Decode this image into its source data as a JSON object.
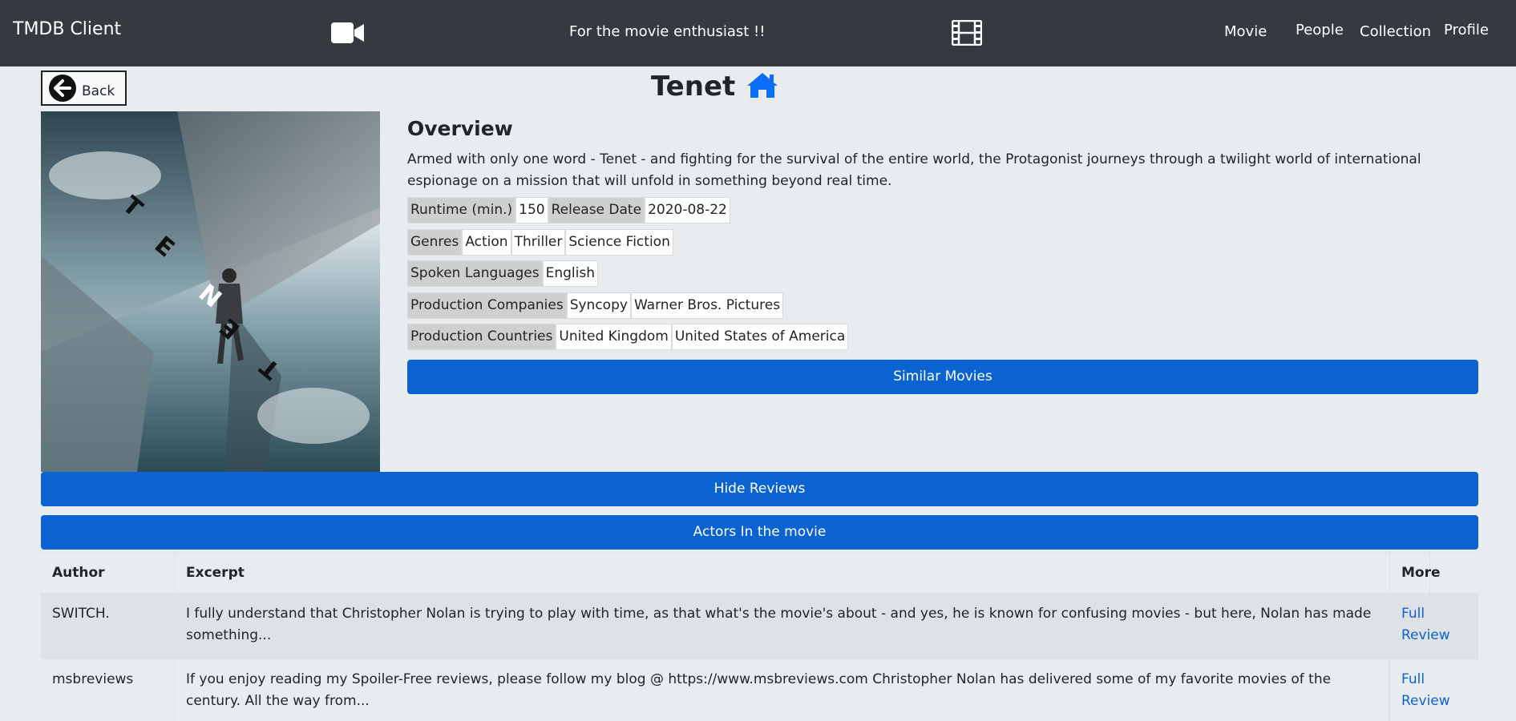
{
  "navbar": {
    "brand": "TMDB Client",
    "camera_icon": "video-camera-icon",
    "tagline": "For the movie enthusiast !!",
    "film_icon": "film-icon",
    "links": [
      "Movie",
      "People",
      "Collection",
      "Profile"
    ]
  },
  "back": {
    "label": "Back",
    "icon": "arrow-left-circle-icon"
  },
  "movie": {
    "title": "Tenet",
    "home_icon": "home-icon",
    "poster_text": "TENET",
    "overview_heading": "Overview",
    "overview": "Armed with only one word - Tenet - and fighting for the survival of the entire world, the Protagonist journeys through a twilight world of international espionage on a mission that will unfold in something beyond real time.",
    "runtime_label": "Runtime (min.)",
    "runtime": "150",
    "release_label": "Release Date",
    "release_date": "2020-08-22",
    "genres_label": "Genres",
    "genres": [
      "Action",
      "Thriller",
      "Science Fiction"
    ],
    "languages_label": "Spoken Languages",
    "languages": [
      "English"
    ],
    "companies_label": "Production Companies",
    "companies": [
      "Syncopy",
      "Warner Bros. Pictures"
    ],
    "countries_label": "Production Countries",
    "countries": [
      "United Kingdom",
      "United States of America"
    ]
  },
  "buttons": {
    "similar": "Similar Movies",
    "hide_reviews": "Hide Reviews",
    "actors": "Actors In the movie"
  },
  "reviews": {
    "columns": [
      "Author",
      "Excerpt",
      "More"
    ],
    "rows": [
      {
        "author": "SWITCH.",
        "excerpt": "I fully understand that Christopher Nolan is trying to play with time, as that what's the movie's about - and yes, he is known for confusing movies - but here, Nolan has made something...",
        "more": "Full Review"
      },
      {
        "author": "msbreviews",
        "excerpt": "If you enjoy reading my Spoiler-Free reviews, please follow my blog @ https://www.msbreviews.com Christopher Nolan has delivered some of my favorite movies of the century. All the way from...",
        "more": "Full Review"
      }
    ]
  },
  "colors": {
    "navbar": "#343a40",
    "primary": "#0b63d2",
    "page": "#e9ecef"
  }
}
